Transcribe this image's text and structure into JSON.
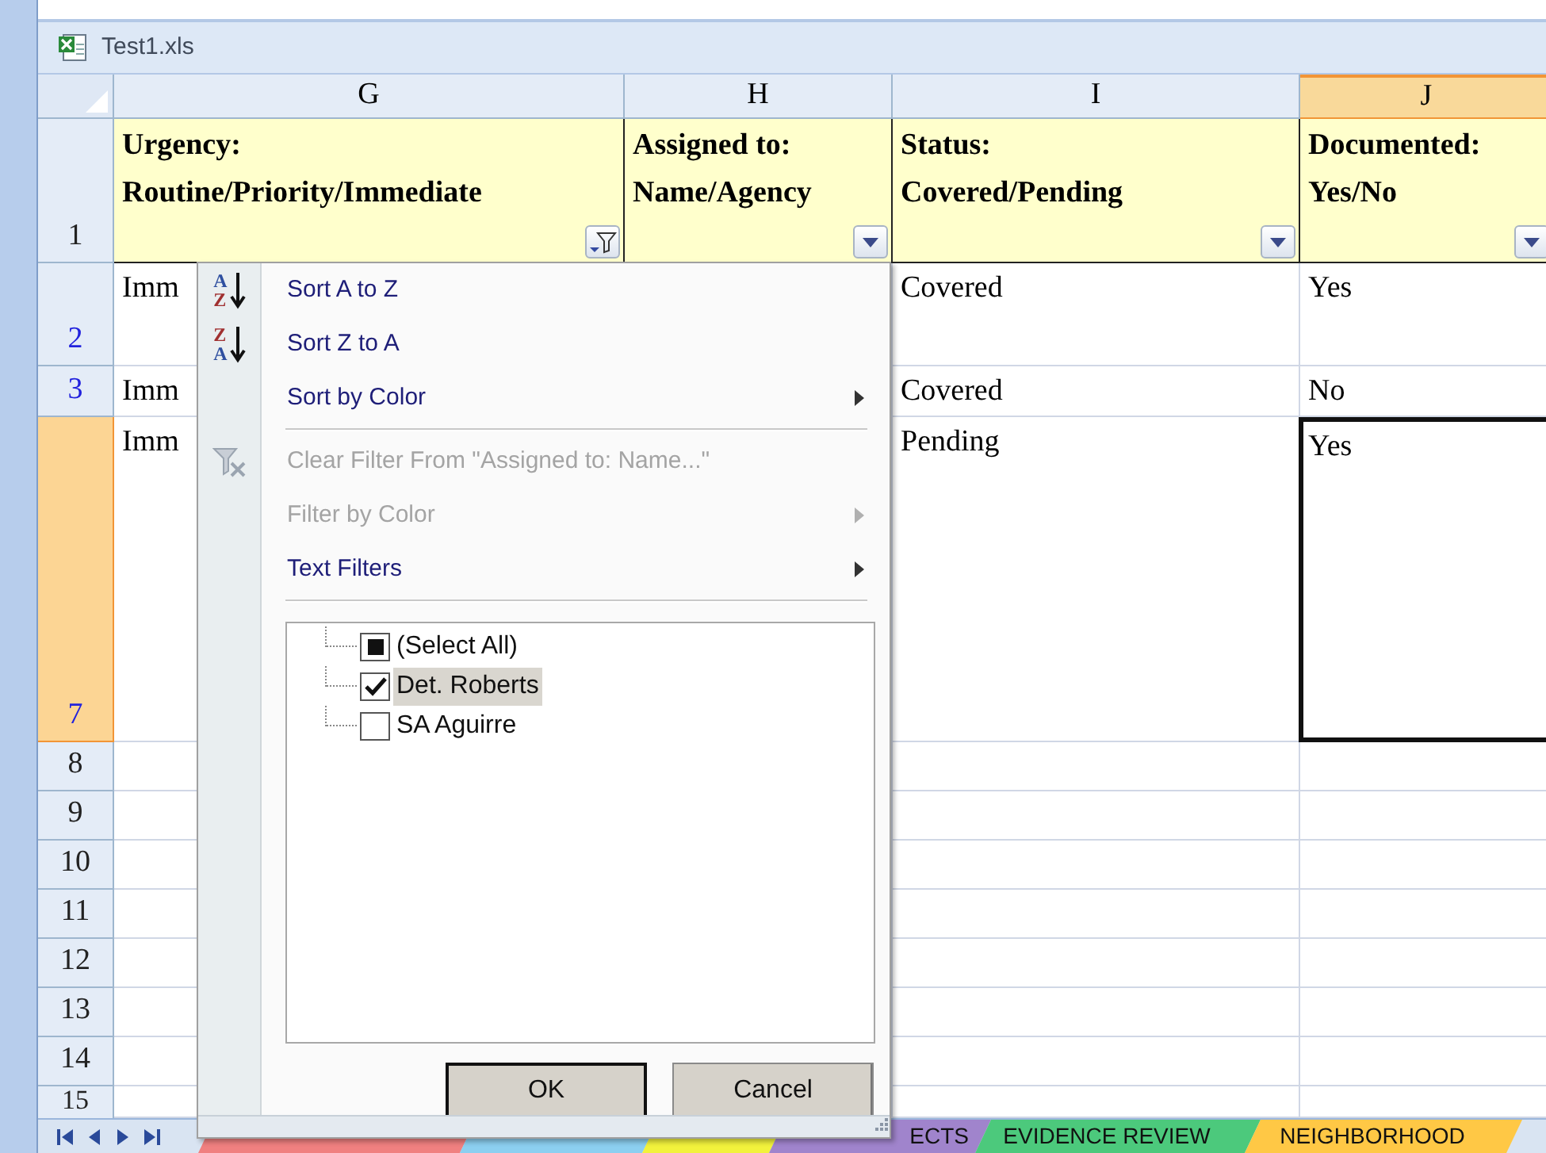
{
  "window": {
    "title": "Test1.xls"
  },
  "columns": [
    {
      "label": "G",
      "selected": false,
      "heading": "Urgency:\nRoutine/Priority/Immediate",
      "filter_active": true
    },
    {
      "label": "H",
      "selected": false,
      "heading": "Assigned to:\nName/Agency",
      "filter_active": false
    },
    {
      "label": "I",
      "selected": false,
      "heading": "Status:\nCovered/Pending",
      "filter_active": false
    },
    {
      "label": "J",
      "selected": true,
      "heading": "Documented:\nYes/No",
      "filter_active": false
    }
  ],
  "header_row": {
    "number": "1",
    "selected": false,
    "filtered": false
  },
  "rows": [
    {
      "number": "2",
      "selected": false,
      "filtered": true,
      "cells": [
        {
          "text": "Imm",
          "active": false
        },
        null,
        {
          "text": "Covered",
          "active": false
        },
        {
          "text": "Yes",
          "active": false
        }
      ]
    },
    {
      "number": "3",
      "selected": false,
      "filtered": true,
      "cells": [
        {
          "text": "Imm",
          "active": false
        },
        null,
        {
          "text": "Covered",
          "active": false
        },
        {
          "text": "No",
          "active": false
        }
      ]
    },
    {
      "number": "7",
      "selected": true,
      "filtered": true,
      "cells": [
        {
          "text": "Imm",
          "active": false
        },
        null,
        {
          "text": "Pending",
          "active": false
        },
        {
          "text": "Yes",
          "active": true
        }
      ]
    },
    {
      "number": "8",
      "selected": false,
      "filtered": false,
      "cells": []
    },
    {
      "number": "9",
      "selected": false,
      "filtered": false,
      "cells": []
    },
    {
      "number": "10",
      "selected": false,
      "filtered": false,
      "cells": []
    },
    {
      "number": "11",
      "selected": false,
      "filtered": false,
      "cells": []
    },
    {
      "number": "12",
      "selected": false,
      "filtered": false,
      "cells": []
    },
    {
      "number": "13",
      "selected": false,
      "filtered": false,
      "cells": []
    },
    {
      "number": "14",
      "selected": false,
      "filtered": false,
      "cells": []
    },
    {
      "number": "15",
      "selected": false,
      "filtered": false,
      "cells": []
    }
  ],
  "filter_menu": {
    "items": [
      {
        "kind": "sort-ascending",
        "icon_letters": [
          "A",
          "Z"
        ],
        "label": "Sort A to Z",
        "disabled": false,
        "submenu": false
      },
      {
        "kind": "sort-descending",
        "icon_letters": [
          "Z",
          "A"
        ],
        "label": "Sort Z to A",
        "disabled": false,
        "submenu": false
      },
      {
        "kind": "command",
        "label": "Sort by Color",
        "disabled": false,
        "submenu": true
      },
      {
        "kind": "separator"
      },
      {
        "kind": "clear-filter",
        "label": "Clear Filter From \"Assigned to: Name...\"",
        "disabled": true,
        "submenu": false
      },
      {
        "kind": "command",
        "label": "Filter by Color",
        "disabled": true,
        "submenu": true
      },
      {
        "kind": "command",
        "label": "Text Filters",
        "disabled": false,
        "submenu": true
      },
      {
        "kind": "separator"
      }
    ],
    "values": [
      {
        "label": "(Select All)",
        "partial": true,
        "selected": false
      },
      {
        "label": "Det. Roberts",
        "checked": true,
        "selected": true
      },
      {
        "label": "SA Aguirre",
        "checked": false,
        "selected": false
      }
    ],
    "buttons": [
      {
        "label": "OK",
        "default": true
      },
      {
        "label": "Cancel",
        "default": false
      }
    ]
  },
  "sheet_tabs": [
    {
      "color": "#f08080"
    },
    {
      "color": "#8ccff0"
    },
    {
      "color": "#f2f23c"
    },
    {
      "label": "ECTS",
      "color": "#a084cc"
    },
    {
      "label": "EVIDENCE REVIEW",
      "color": "#4cc97c"
    },
    {
      "label": "NEIGHBORHOOD",
      "color": "#ffc845"
    }
  ]
}
